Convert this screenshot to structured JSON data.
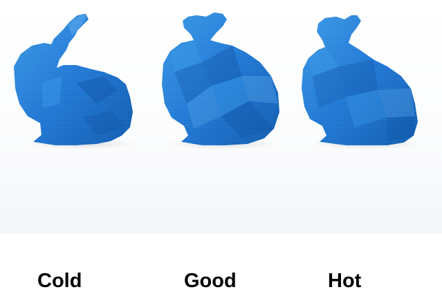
{
  "photo": {
    "subject_color": "#1f77d4",
    "shadow_color": "#1256a6",
    "highlight_color": "#5fb0f0",
    "background_color": "#ffffff"
  },
  "captions": {
    "cold": "Cold",
    "good": "Good",
    "hot": "Hot"
  }
}
